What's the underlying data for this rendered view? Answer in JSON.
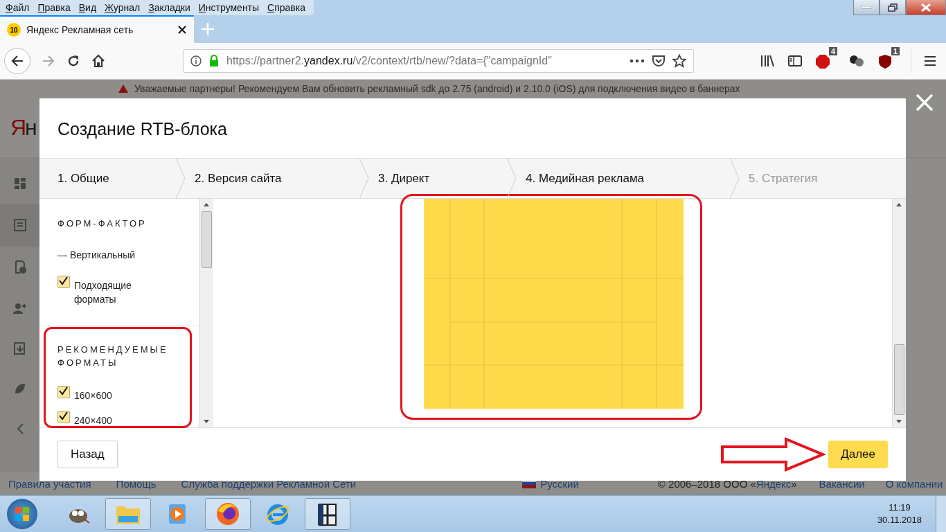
{
  "browser": {
    "menu": [
      "Файл",
      "Правка",
      "Вид",
      "Журнал",
      "Закладки",
      "Инструменты",
      "Справка"
    ],
    "tab": {
      "badge": "10",
      "title": "Яндекс Рекламная сеть"
    },
    "url": {
      "scheme": "https://partner2.",
      "host": "yandex.ru",
      "path": "/v2/context/rtb/new/?data={\"campaignId\""
    },
    "extensions": [
      {
        "kind": "abp",
        "badge": "4"
      },
      {
        "kind": "ublock",
        "badge": "1"
      }
    ]
  },
  "page": {
    "banner": "Уважаемые партнеры! Рекомендуем Вам обновить рекламный sdk до 2.75 (android) и 2.10.0 (iOS) для подключения видео в баннерах",
    "logo": "Ян",
    "footer_links": [
      "Правила участия",
      "Помощь",
      "Служба поддержки Рекламной Сети"
    ],
    "language": "Русский",
    "copyright": {
      "prefix": "© 2006–2018 ООО «",
      "link": "Яндекс",
      "suffix": "»"
    },
    "right_links": [
      "Вакансии",
      "О компании"
    ]
  },
  "modal": {
    "title": "Создание RTB-блока",
    "steps": [
      {
        "label": "1. Общие",
        "disabled": false
      },
      {
        "label": "2. Версия сайта",
        "disabled": false
      },
      {
        "label": "3. Директ",
        "disabled": false
      },
      {
        "label": "4. Медийная реклама",
        "disabled": false
      },
      {
        "label": "5. Стратегия",
        "disabled": true
      }
    ],
    "sections": [
      {
        "heading": "ФОРМ-ФАКТОР",
        "items": [
          {
            "kind": "text",
            "label": "— Вертикальный"
          },
          {
            "kind": "checkbox",
            "label": "Подходящие форматы",
            "checked": true
          }
        ]
      },
      {
        "heading": "РЕКОМЕНДУЕМЫЕ ФОРМАТЫ",
        "items": [
          {
            "kind": "checkbox",
            "label": "160×600",
            "checked": true
          },
          {
            "kind": "checkbox",
            "label": "240×400",
            "checked": true
          }
        ]
      }
    ],
    "back": "Назад",
    "next": "Далее"
  },
  "taskbar": {
    "time": "11:19",
    "date": "30.11.2018"
  }
}
